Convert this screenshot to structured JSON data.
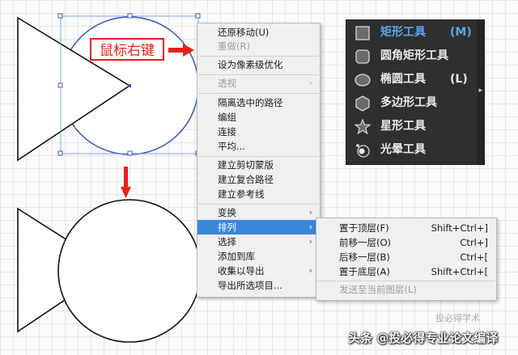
{
  "annotation": {
    "label": "鼠标右键"
  },
  "context_menu": {
    "items": [
      {
        "label": "还原移动(U)",
        "disabled": false
      },
      {
        "label": "重做(R)",
        "disabled": true
      },
      {
        "label": "设为像素级优化",
        "disabled": false
      },
      {
        "label": "透视",
        "disabled": true,
        "submenu": true
      },
      {
        "label": "隔离选中的路径",
        "disabled": false
      },
      {
        "label": "编组",
        "disabled": false
      },
      {
        "label": "连接",
        "disabled": false
      },
      {
        "label": "平均...",
        "disabled": false
      },
      {
        "label": "建立剪切蒙版",
        "disabled": false
      },
      {
        "label": "建立复合路径",
        "disabled": false
      },
      {
        "label": "建立参考线",
        "disabled": false
      },
      {
        "label": "变换",
        "disabled": false,
        "submenu": true
      },
      {
        "label": "排列",
        "disabled": false,
        "submenu": true,
        "highlighted": true
      },
      {
        "label": "选择",
        "disabled": false,
        "submenu": true
      },
      {
        "label": "添加到库",
        "disabled": false
      },
      {
        "label": "收集以导出",
        "disabled": false,
        "submenu": true
      },
      {
        "label": "导出所选项目...",
        "disabled": false
      }
    ],
    "arrow_glyph": "›"
  },
  "arrange_submenu": {
    "items": [
      {
        "label": "置于顶层(F)",
        "shortcut": "Shift+Ctrl+]"
      },
      {
        "label": "前移一层(O)",
        "shortcut": "Ctrl+]"
      },
      {
        "label": "后移一层(B)",
        "shortcut": "Ctrl+["
      },
      {
        "label": "置于底层(A)",
        "shortcut": "Shift+Ctrl+["
      },
      {
        "label": "发送至当前图层(L)",
        "shortcut": "",
        "disabled": true
      }
    ]
  },
  "tool_panel": {
    "tools": [
      {
        "label": "矩形工具",
        "key": "(M)",
        "icon": "rectangle-tool-icon",
        "selected": true
      },
      {
        "label": "圆角矩形工具",
        "key": "",
        "icon": "rounded-rectangle-tool-icon"
      },
      {
        "label": "椭圆工具",
        "key": "(L)",
        "icon": "ellipse-tool-icon"
      },
      {
        "label": "多边形工具",
        "key": "",
        "icon": "polygon-tool-icon"
      },
      {
        "label": "星形工具",
        "key": "",
        "icon": "star-tool-icon"
      },
      {
        "label": "光晕工具",
        "key": "",
        "icon": "flare-tool-icon"
      }
    ],
    "accent": "#5aa5f5"
  },
  "watermark": {
    "text": "头条 @投必得专业论文编译",
    "small": "投必得学术"
  },
  "colors": {
    "annotation_red": "#e2231a",
    "selection_blue": "#3c5ca8",
    "menu_highlight": "#3c87d8"
  }
}
